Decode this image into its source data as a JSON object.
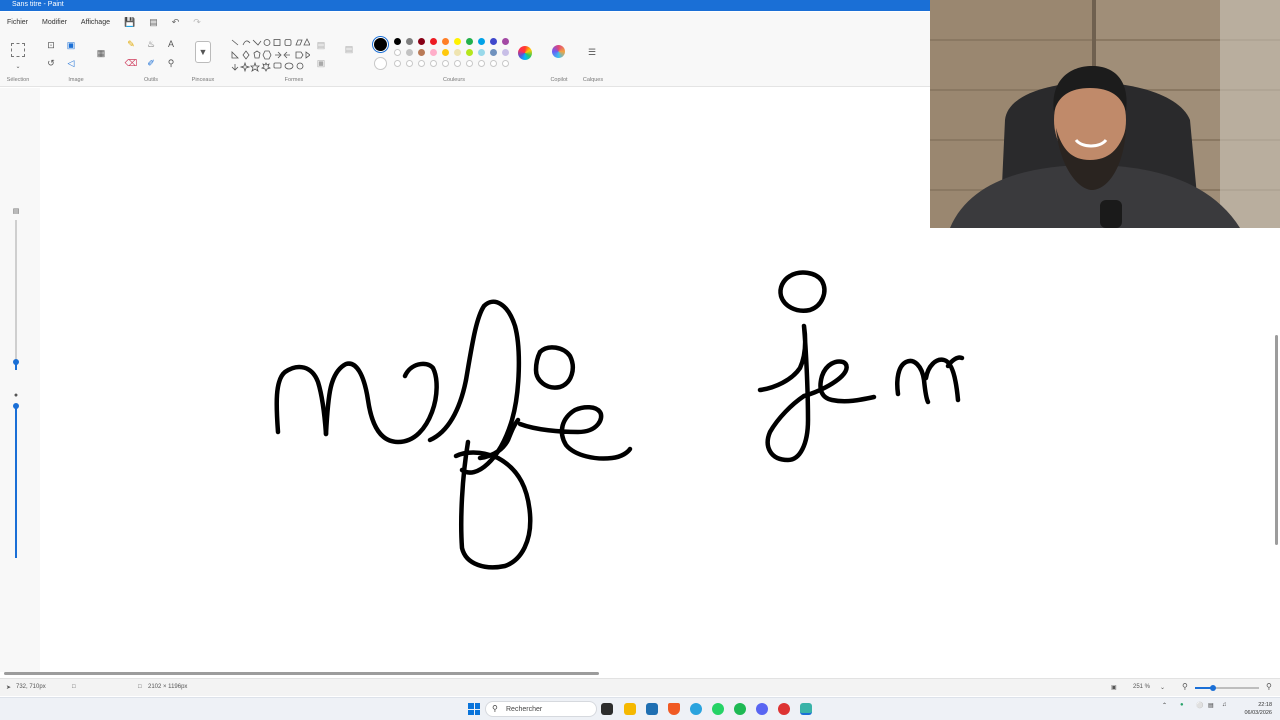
{
  "window": {
    "title": "Sans titre - Paint"
  },
  "menu": {
    "items": [
      "Fichier",
      "Modifier",
      "Affichage"
    ],
    "quick_icons": [
      "save-icon",
      "share-icon",
      "undo-icon",
      "redo-icon"
    ]
  },
  "ribbon": {
    "groups": {
      "selection": "Sélection",
      "image": "Image",
      "tools": "Outils",
      "brushes": "Pinceaux",
      "shapes": "Formes",
      "colors": "Couleurs",
      "copilot": "Copilot",
      "layers": "Calques"
    },
    "primary_color": "#000000",
    "secondary_color": "#ffffff",
    "palette_row1": [
      "#000000",
      "#7f7f7f",
      "#880015",
      "#ed1c24",
      "#ff7f27",
      "#fff200",
      "#22b14c",
      "#00a2e8",
      "#3f48cc",
      "#a349a4"
    ],
    "palette_row2": [
      "#ffffff",
      "#c3c3c3",
      "#b97a57",
      "#ffaec9",
      "#ffc90e",
      "#efe4b0",
      "#b5e61d",
      "#99d9ea",
      "#7092be",
      "#c8bfe7"
    ]
  },
  "canvas": {
    "handwriting": "nafie je m"
  },
  "status": {
    "cursor_pos": "732, 710px",
    "canvas_size": "2102 × 1196px",
    "zoom": "251 %"
  },
  "taskbar": {
    "search_placeholder": "Rechercher",
    "time": "22:18",
    "date": "06/03/2026"
  }
}
